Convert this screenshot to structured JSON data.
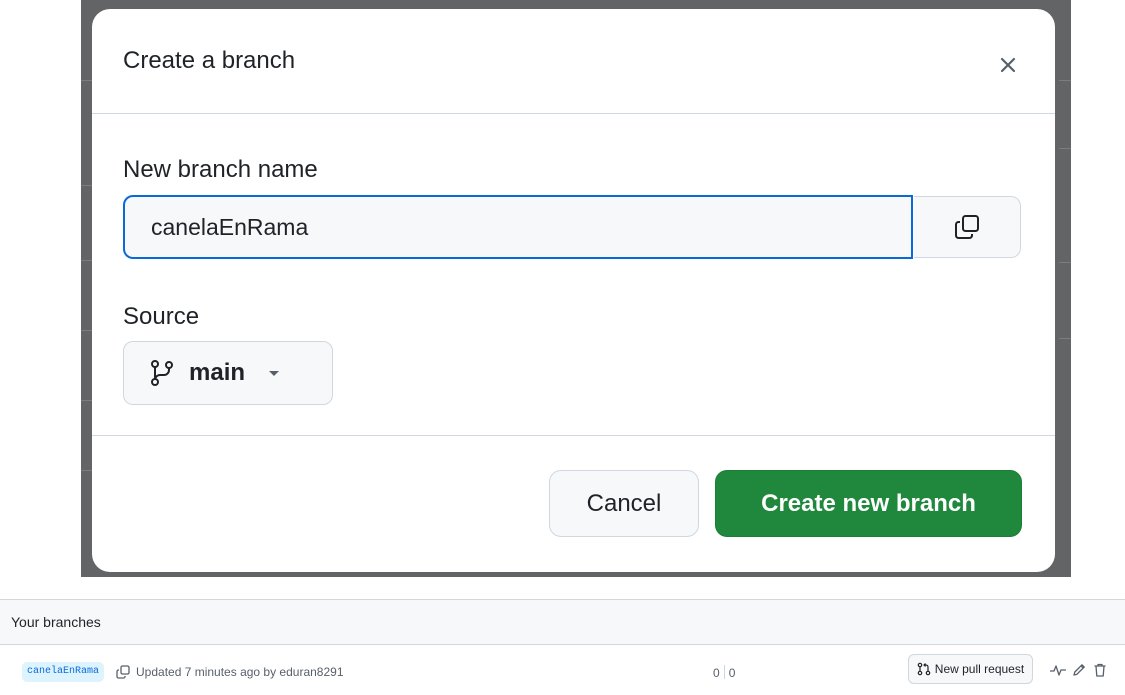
{
  "dialog": {
    "title": "Create a branch",
    "close_icon": "close-icon",
    "name_label": "New branch name",
    "name_value": "canelaEnRama",
    "copy_icon": "copy-icon",
    "source_label": "Source",
    "source_branch": "main",
    "source_icons": [
      "git-branch-icon",
      "triangle-down-icon"
    ],
    "cancel_label": "Cancel",
    "create_label": "Create new branch",
    "colors": {
      "primary": "#1f883d",
      "focus": "#0969da"
    }
  },
  "branches": {
    "section_title": "Your branches",
    "row": {
      "name": "canelaEnRama",
      "updated_text": "Updated 7 minutes ago by eduran8291",
      "behind": "0",
      "ahead": "0",
      "pr_label": "New pull request",
      "icons": [
        "copy-icon",
        "git-pull-request-icon",
        "pulse-icon",
        "pencil-icon",
        "trash-icon"
      ]
    }
  }
}
